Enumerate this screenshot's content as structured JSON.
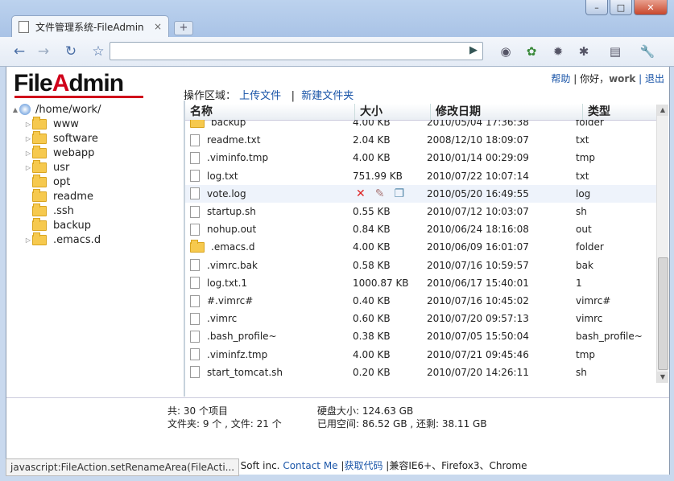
{
  "browser": {
    "tab_title": "文件管理系统-FileAdmin",
    "tab_close": "×",
    "new_tab": "+",
    "window_buttons": [
      "–",
      "□",
      "✕"
    ]
  },
  "header": {
    "logo_part1": "File",
    "logo_part2": "A",
    "logo_part3": "dmin",
    "ops_label": "操作区域：",
    "upload": "上传文件",
    "separator": "|",
    "new_folder": "新建文件夹",
    "help": "帮助",
    "hello": "| 你好，",
    "user": "work",
    "logout": "| 退出"
  },
  "tree": {
    "root": "/home/work/",
    "items": [
      {
        "label": "www",
        "expandable": true
      },
      {
        "label": "software",
        "expandable": true
      },
      {
        "label": "webapp",
        "expandable": true
      },
      {
        "label": "usr",
        "expandable": true
      },
      {
        "label": "opt",
        "expandable": false
      },
      {
        "label": "readme",
        "expandable": false
      },
      {
        "label": ".ssh",
        "expandable": false
      },
      {
        "label": "backup",
        "expandable": false
      },
      {
        "label": ".emacs.d",
        "expandable": true
      }
    ]
  },
  "list": {
    "columns": [
      "名称",
      "大小",
      "修改日期",
      "类型"
    ],
    "rows": [
      {
        "name": "backup",
        "size": "4.00 KB",
        "date": "2010/05/04 17:36:38",
        "type": "folder",
        "folder": true
      },
      {
        "name": "readme.txt",
        "size": "2.04 KB",
        "date": "2008/12/10 18:09:07",
        "type": "txt"
      },
      {
        "name": ".viminfo.tmp",
        "size": "4.00 KB",
        "date": "2010/01/14 00:29:09",
        "type": "tmp"
      },
      {
        "name": "log.txt",
        "size": "751.99 KB",
        "date": "2010/07/22 10:07:14",
        "type": "txt"
      },
      {
        "name": "vote.log",
        "size": "",
        "date": "2010/05/20 16:49:55",
        "type": "log",
        "hover": true
      },
      {
        "name": "startup.sh",
        "size": "0.55 KB",
        "date": "2010/07/12 10:03:07",
        "type": "sh"
      },
      {
        "name": "nohup.out",
        "size": "0.84 KB",
        "date": "2010/06/24 18:16:08",
        "type": "out"
      },
      {
        "name": ".emacs.d",
        "size": "4.00 KB",
        "date": "2010/06/09 16:01:07",
        "type": "folder",
        "folder": true
      },
      {
        "name": ".vimrc.bak",
        "size": "0.58 KB",
        "date": "2010/07/16 10:59:57",
        "type": "bak"
      },
      {
        "name": "log.txt.1",
        "size": "1000.87 KB",
        "date": "2010/06/17 15:40:01",
        "type": "1"
      },
      {
        "name": "#.vimrc#",
        "size": "0.40 KB",
        "date": "2010/07/16 10:45:02",
        "type": "vimrc#"
      },
      {
        "name": ".vimrc",
        "size": "0.60 KB",
        "date": "2010/07/20 09:57:13",
        "type": "vimrc"
      },
      {
        "name": ".bash_profile~",
        "size": "0.38 KB",
        "date": "2010/07/05 15:50:04",
        "type": "bash_profile~"
      },
      {
        "name": ".viminfz.tmp",
        "size": "4.00 KB",
        "date": "2010/07/21 09:45:46",
        "type": "tmp"
      },
      {
        "name": "start_tomcat.sh",
        "size": "0.20 KB",
        "date": "2010/07/20 14:26:11",
        "type": "sh"
      }
    ]
  },
  "summary": {
    "total": "共: 30 个项目",
    "counts": "文件夹: 9 个 , 文件: 21 个",
    "disk": "硬盘大小: 124.63 GB",
    "usage": "已用空间: 86.52 GB , 还剩: 38.11 GB"
  },
  "footer": {
    "copyright": "oungli Soft inc.",
    "contact": "Contact Me",
    "sep": "|",
    "get_code": "获取代码",
    "compat": "|兼容IE6+、Firefox3、Chrome"
  },
  "statusbar": "javascript:FileAction.setRenameArea(FileActi..."
}
